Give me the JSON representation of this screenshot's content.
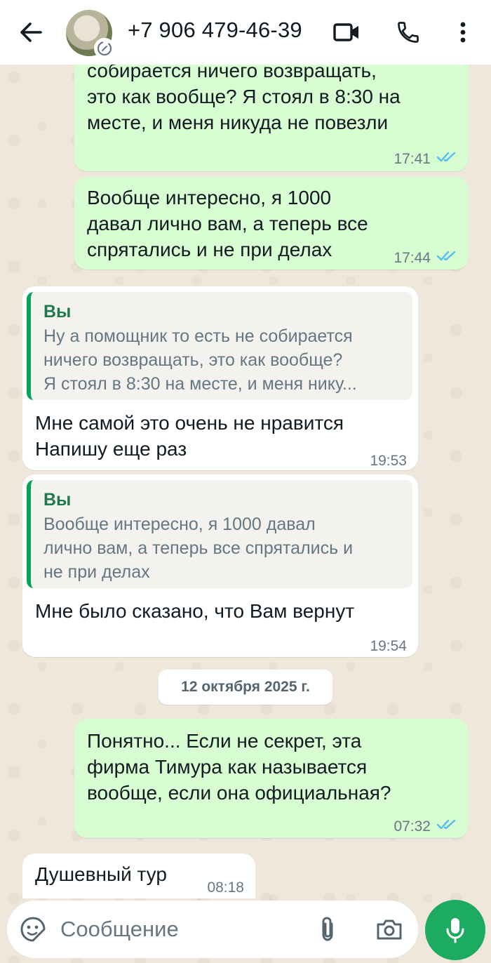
{
  "header": {
    "contact_name": "+7 906 479-46-39"
  },
  "colors": {
    "header_bg": "#ffffff",
    "outgoing_bubble": "#d9fdd3",
    "incoming_bubble": "#ffffff",
    "accent": "#1daa61",
    "read_ticks": "#53bdeb"
  },
  "icons": {
    "back": "arrow-left-icon",
    "video": "video-camera-icon",
    "call": "phone-icon",
    "menu": "more-vertical-icon",
    "emoji": "sticker-emoji-icon",
    "attach": "paperclip-icon",
    "camera": "camera-icon",
    "mic": "microphone-icon"
  },
  "messages": [
    {
      "direction": "out",
      "text": "собирается ничего возвращать,\nэто как вообще? Я стоял в 8:30 на\nместе, и меня никуда не повезли",
      "time": "17:41",
      "status": "read"
    },
    {
      "direction": "out",
      "text": "Вообще интересно, я 1000\nдавал лично вам, а теперь все\nспрятались и не при делах",
      "time": "17:44",
      "status": "read"
    },
    {
      "direction": "in",
      "quote_author": "Вы",
      "quote_text": "Ну а помощник то есть не собирается\nничего возвращать, это как вообще?\nЯ стоял в 8:30 на месте, и меня нику...",
      "text": "Мне самой это очень не нравится\nНапишу еще раз",
      "time": "19:53"
    },
    {
      "direction": "in",
      "quote_author": "Вы",
      "quote_text": "Вообще интересно, я 1000 давал\nлично вам, а теперь все спрятались и\nне при делах",
      "text": "Мне было сказано, что Вам вернут",
      "time": "19:54"
    },
    {
      "direction": "out",
      "text": "Понятно... Если не секрет, эта\nфирма Тимура как называется\nвообще, если она официальная?",
      "time": "07:32",
      "status": "read"
    },
    {
      "direction": "in",
      "text": "Душевный тур",
      "time": "08:18"
    }
  ],
  "date_separator": "12 октября 2025 г.",
  "composer": {
    "placeholder": "Сообщение"
  }
}
